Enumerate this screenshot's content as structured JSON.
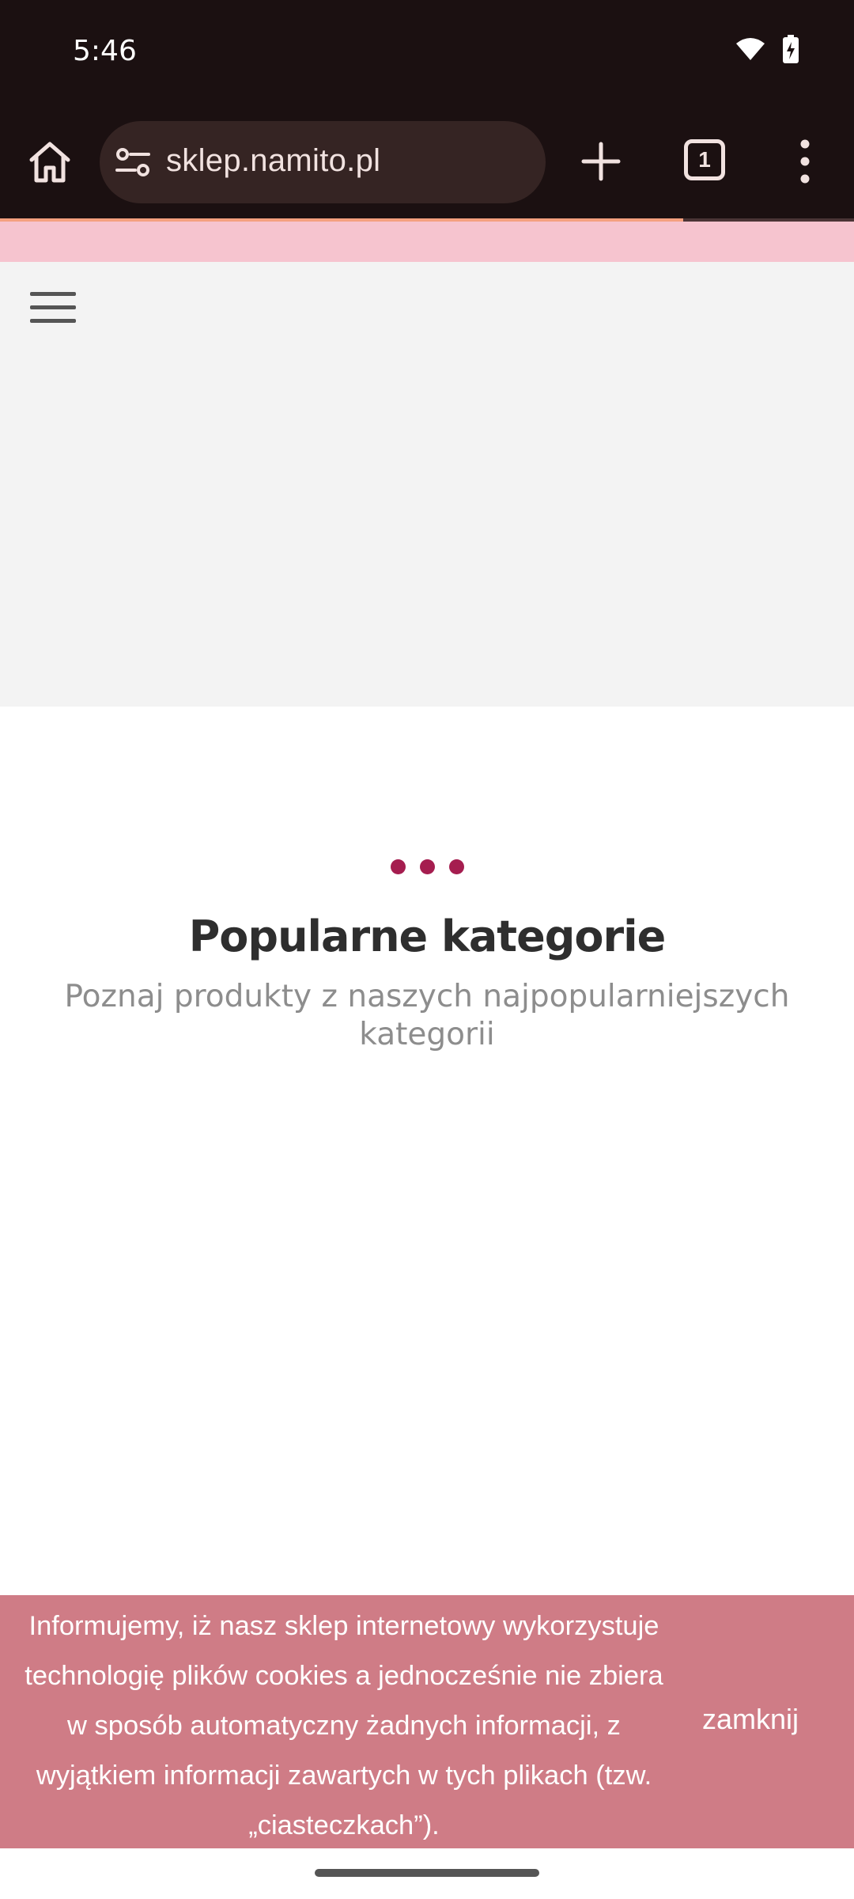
{
  "status_bar": {
    "time": "5:46",
    "icons": [
      "wifi-icon",
      "battery-charging-icon"
    ]
  },
  "browser": {
    "url": "sklep.namito.pl",
    "tab_count": "1",
    "load_progress": 0.8,
    "icons": [
      "home-icon",
      "site-info-icon",
      "plus-icon",
      "tabs-icon",
      "more-vert-icon"
    ]
  },
  "page": {
    "menu_icon": "hamburger-icon",
    "section": {
      "title": "Popularne kategorie",
      "subtitle": "Poznaj produkty z naszych najpopularniejszych kategorii"
    }
  },
  "cookie_banner": {
    "lines": [
      "Informujemy, iż nasz sklep internetowy wykorzystuje",
      "technologię plików cookies a jednocześnie nie zbiera",
      "w sposób automatyczny żadnych informacji, z",
      "wyjątkiem informacji zawartych w tych plikach (tzw.",
      "„ciasteczkach”)."
    ],
    "close_label": "zamknij"
  },
  "colors": {
    "browser_chrome": "#1b1011",
    "url_bar": "#352423",
    "progress": "#f4a07f",
    "promo_strip": "#f6c4cf",
    "loader_dots": "#a51d4f",
    "cookie_banner": "#cf7c86"
  }
}
